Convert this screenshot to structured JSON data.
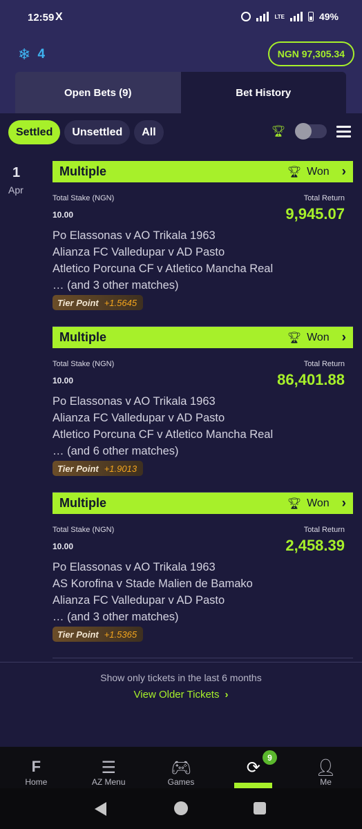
{
  "status_bar": {
    "time": "12:59",
    "x_icon": "X",
    "network": "LTE",
    "battery": "49%"
  },
  "header": {
    "freeze_count": "4",
    "balance": "NGN 97,305.34"
  },
  "tabs": [
    {
      "label": "Open Bets (9)"
    },
    {
      "label": "Bet History"
    }
  ],
  "filters": [
    {
      "label": "Settled"
    },
    {
      "label": "Unsettled"
    },
    {
      "label": "All"
    }
  ],
  "date": {
    "day": "1",
    "month": "Apr"
  },
  "bets": [
    {
      "type": "Multiple",
      "status": "Won",
      "stake_label": "Total Stake (NGN)",
      "stake": "10.00",
      "return_label": "Total Return",
      "return": "9,945.07",
      "matches": [
        "Po Elassonas v AO Trikala 1963",
        "Alianza FC Valledupar v AD Pasto",
        "Atletico Porcuna CF v Atletico Mancha Real",
        "… (and 3 other matches)"
      ],
      "tier_label": "Tier Point",
      "tier_value": "+1.5645"
    },
    {
      "type": "Multiple",
      "status": "Won",
      "stake_label": "Total Stake (NGN)",
      "stake": "10.00",
      "return_label": "Total Return",
      "return": "86,401.88",
      "matches": [
        "Po Elassonas v AO Trikala 1963",
        "Alianza FC Valledupar v AD Pasto",
        "Atletico Porcuna CF v Atletico Mancha Real",
        "… (and 6 other matches)"
      ],
      "tier_label": "Tier Point",
      "tier_value": "+1.9013"
    },
    {
      "type": "Multiple",
      "status": "Won",
      "stake_label": "Total Stake (NGN)",
      "stake": "10.00",
      "return_label": "Total Return",
      "return": "2,458.39",
      "matches": [
        "Po Elassonas v AO Trikala 1963",
        "AS Korofina v Stade Malien de Bamako",
        "Alianza FC Valledupar v AD Pasto",
        "… (and 3 other matches)"
      ],
      "tier_label": "Tier Point",
      "tier_value": "+1.5365"
    }
  ],
  "footer": {
    "show_only": "Show only tickets in the last 6 months",
    "view_older": "View Older Tickets"
  },
  "bottom_nav": [
    {
      "label": "Home",
      "icon": "home-icon"
    },
    {
      "label": "AZ Menu",
      "icon": "az-menu-icon"
    },
    {
      "label": "Games",
      "icon": "gamepad-icon"
    },
    {
      "label": "",
      "icon": "bets-icon",
      "badge": "9"
    },
    {
      "label": "Me",
      "icon": "user-icon"
    }
  ],
  "colors": {
    "accent": "#a7f02a",
    "background": "#1c1a3b",
    "header": "#2d2a5c",
    "freeze": "#3eb3f0",
    "tier_value": "#f3a51e"
  }
}
